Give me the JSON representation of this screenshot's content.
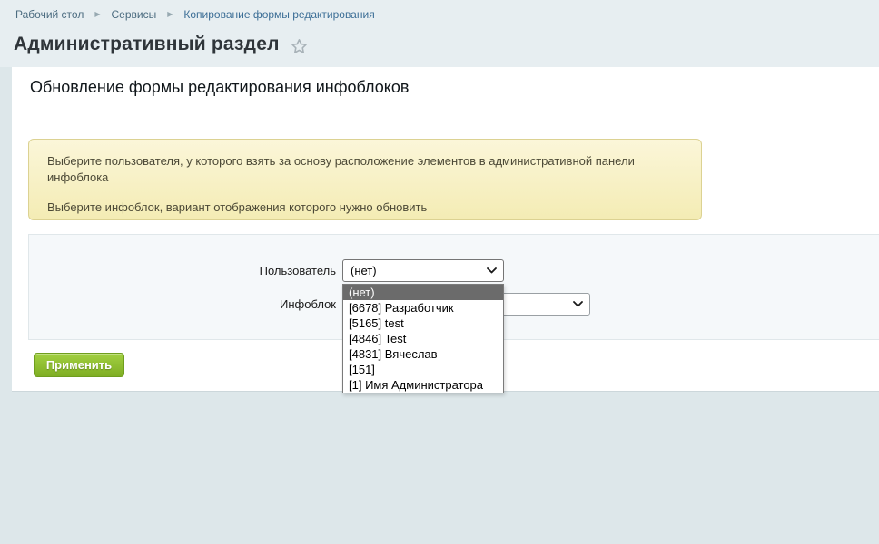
{
  "breadcrumb": {
    "items": [
      {
        "label": "Рабочий стол"
      },
      {
        "label": "Сервисы"
      },
      {
        "label": "Копирование формы редактирования"
      }
    ]
  },
  "header": {
    "title": "Административный раздел",
    "favorite_icon": "star-outline"
  },
  "page": {
    "title": "Обновление формы редактирования инфоблоков",
    "notes": [
      "Выберите пользователя, у которого взять за основу расположение элементов в административной панели инфоблока",
      "Выберите инфоблок, вариант отображения которого нужно обновить"
    ]
  },
  "form": {
    "fields": [
      {
        "label": "Пользователь",
        "value": "(нет)"
      },
      {
        "label": "Инфоблок",
        "value": ""
      }
    ],
    "user_dropdown": {
      "highlighted_index": 0,
      "options": [
        "(нет)",
        "[6678] Разработчик",
        "[5165] test",
        "[4846] Test",
        "[4831] Вячеслав",
        "[151]",
        "[1] Имя Администратора"
      ]
    },
    "apply_button": "Применить"
  },
  "colors": {
    "page_background": "#dde7ea",
    "header_background": "#e7eef1",
    "note_background": "#f7efc4",
    "note_border": "#dcd292",
    "panel_background": "#f5f8fa",
    "accent_green": "#8cbb2a",
    "dropdown_highlight": "#6b6b6b",
    "breadcrumb_link": "#4c6c80"
  }
}
